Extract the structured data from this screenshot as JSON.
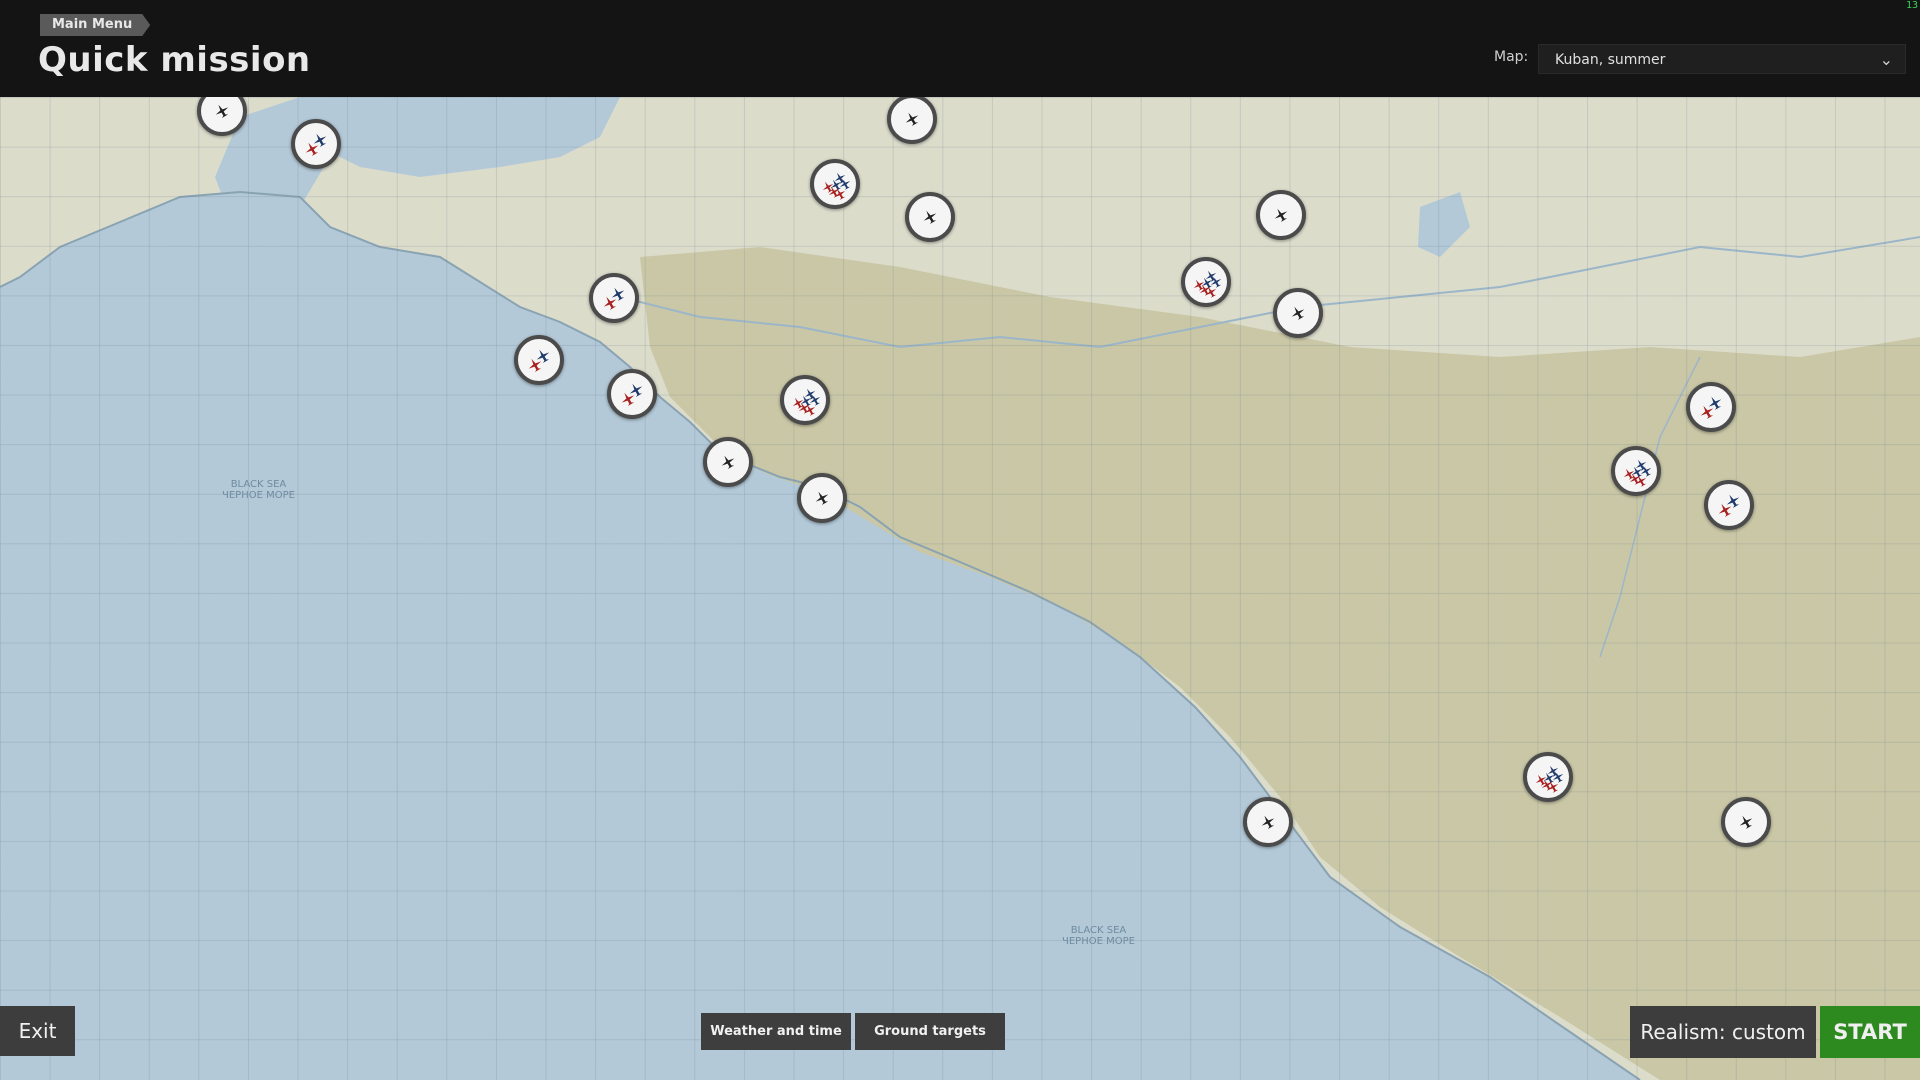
{
  "header": {
    "breadcrumb": "Main Menu",
    "title": "Quick mission",
    "map_label": "Map:",
    "map_value": "Kuban, summer",
    "corner_indicator": "13"
  },
  "map": {
    "sea_labels": [
      {
        "text": "BLACK SEA\nЧЕРНОЕ МОРЕ"
      },
      {
        "text": "BLACK SEA\nЧЕРНОЕ МОРЕ"
      }
    ],
    "airfield_types": [
      "single-neutral",
      "mixed-small",
      "single-neutral",
      "mixed-group",
      "single-neutral",
      "mixed-small",
      "single-neutral",
      "mixed-group",
      "mixed-small",
      "single-neutral",
      "mixed-small",
      "mixed-group",
      "single-neutral",
      "mixed-small",
      "mixed-group",
      "single-neutral",
      "mixed-small",
      "mixed-group",
      "single-neutral",
      "single-neutral",
      "single-neutral",
      "single-neutral"
    ],
    "colors": {
      "sea": "#b3c9d8",
      "land": "#dcdccb",
      "highland": "#c6c4a4",
      "ally": "#1f3a6b",
      "axis": "#a82020"
    }
  },
  "footer": {
    "exit_label": "Exit",
    "weather_label": "Weather and time",
    "ground_label": "Ground targets",
    "realism_label": "Realism: custom",
    "start_label": "START"
  }
}
